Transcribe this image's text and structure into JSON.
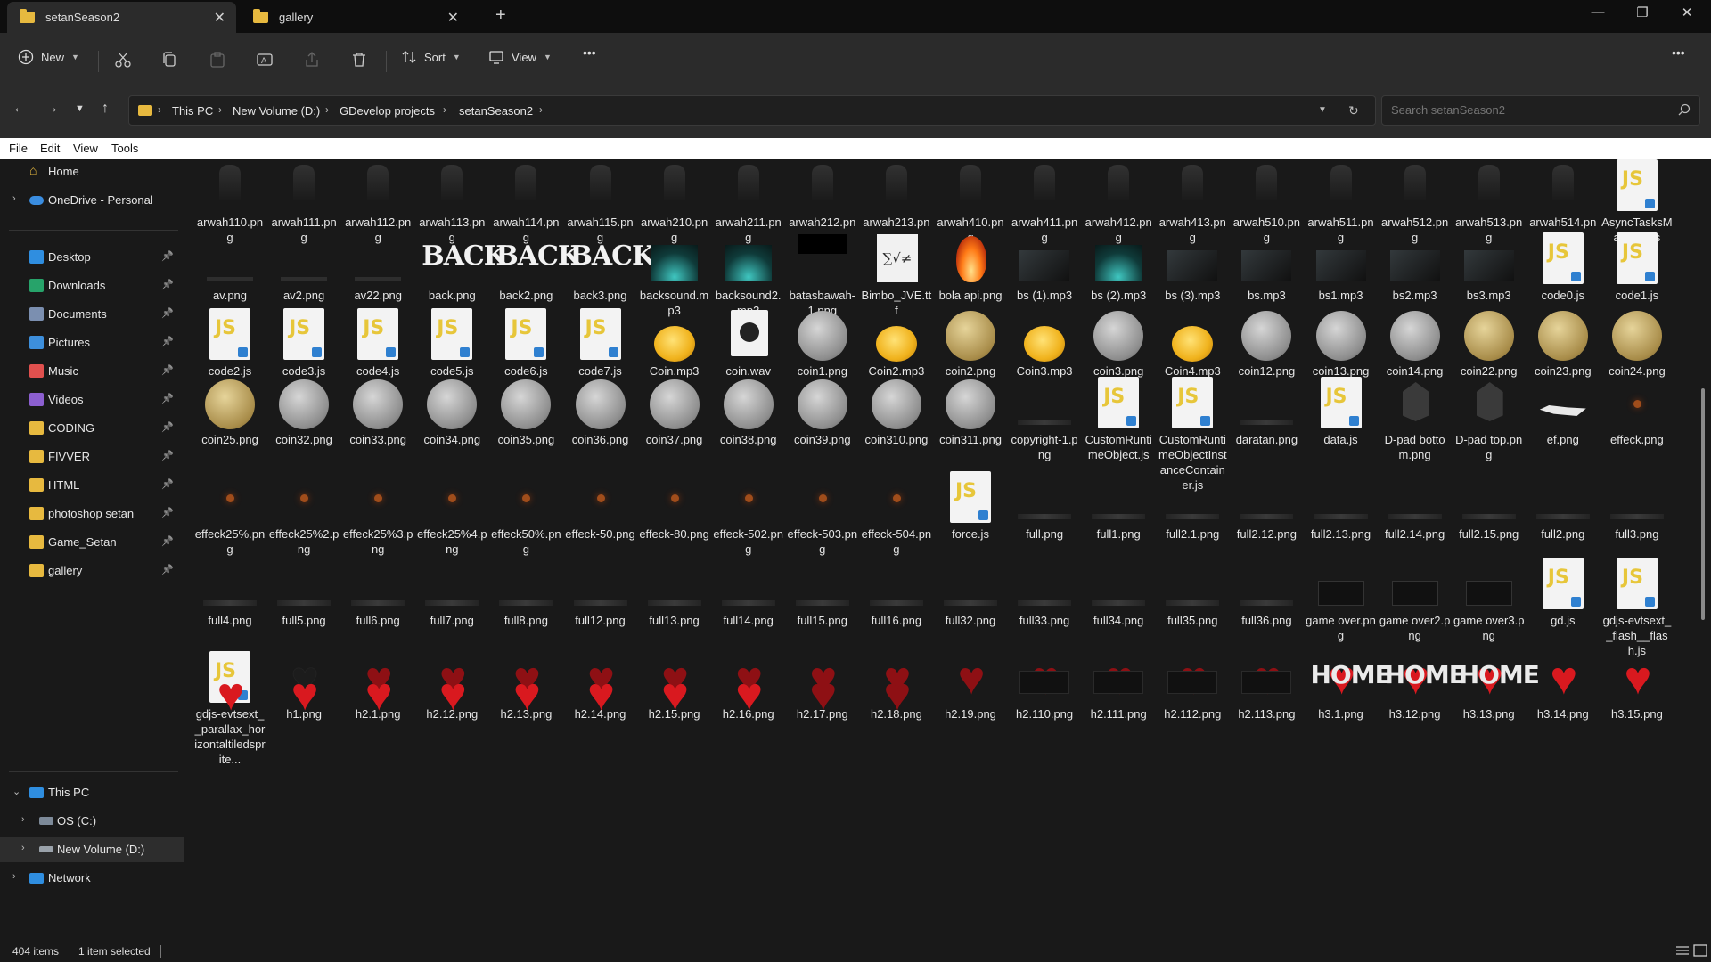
{
  "tabs": [
    {
      "label": "setanSeason2",
      "active": true
    },
    {
      "label": "gallery",
      "active": false
    }
  ],
  "toolbar": {
    "new_label": "New",
    "sort_label": "Sort",
    "view_label": "View",
    "more_label": "•••"
  },
  "breadcrumb": [
    "This PC",
    "New Volume (D:)",
    "GDevelop projects",
    "setanSeason2"
  ],
  "search": {
    "placeholder": "Search setanSeason2"
  },
  "menu": [
    "File",
    "Edit",
    "View",
    "Tools"
  ],
  "sidebar": {
    "home": "Home",
    "onedrive": "OneDrive - Personal",
    "quick": [
      {
        "label": "Desktop",
        "icon": "desktop-icon",
        "color": "#2f8ee0"
      },
      {
        "label": "Downloads",
        "icon": "download-icon",
        "color": "#27a36a"
      },
      {
        "label": "Documents",
        "icon": "documents-icon",
        "color": "#7b8fb0"
      },
      {
        "label": "Pictures",
        "icon": "pictures-icon",
        "color": "#3d8fdc"
      },
      {
        "label": "Music",
        "icon": "music-icon",
        "color": "#e0504e"
      },
      {
        "label": "Videos",
        "icon": "videos-icon",
        "color": "#8c5fd0"
      },
      {
        "label": "CODING",
        "icon": "folder-icon",
        "color": "#e7b93f"
      },
      {
        "label": "FIVVER",
        "icon": "folder-icon",
        "color": "#e7b93f"
      },
      {
        "label": "HTML",
        "icon": "folder-icon",
        "color": "#e7b93f"
      },
      {
        "label": "photoshop setan",
        "icon": "folder-icon",
        "color": "#e7b93f"
      },
      {
        "label": "Game_Setan",
        "icon": "folder-icon",
        "color": "#e7b93f"
      },
      {
        "label": "gallery",
        "icon": "folder-icon",
        "color": "#e7b93f"
      }
    ],
    "this_pc": "This PC",
    "drives": [
      "OS (C:)",
      "New Volume (D:)"
    ],
    "network": "Network"
  },
  "files": [
    {
      "name": "arwah110.png",
      "thumb": "ghost"
    },
    {
      "name": "arwah111.png",
      "thumb": "ghost"
    },
    {
      "name": "arwah112.png",
      "thumb": "ghost"
    },
    {
      "name": "arwah113.png",
      "thumb": "ghost"
    },
    {
      "name": "arwah114.png",
      "thumb": "ghost"
    },
    {
      "name": "arwah115.png",
      "thumb": "ghost"
    },
    {
      "name": "arwah210.png",
      "thumb": "ghost"
    },
    {
      "name": "arwah211.png",
      "thumb": "ghost"
    },
    {
      "name": "arwah212.png",
      "thumb": "ghost"
    },
    {
      "name": "arwah213.png",
      "thumb": "ghost"
    },
    {
      "name": "arwah410.png",
      "thumb": "ghost"
    },
    {
      "name": "arwah411.png",
      "thumb": "ghost"
    },
    {
      "name": "arwah412.png",
      "thumb": "ghost"
    },
    {
      "name": "arwah413.png",
      "thumb": "ghost"
    },
    {
      "name": "arwah510.png",
      "thumb": "ghost"
    },
    {
      "name": "arwah511.png",
      "thumb": "ghost"
    },
    {
      "name": "arwah512.png",
      "thumb": "ghost"
    },
    {
      "name": "arwah513.png",
      "thumb": "ghost"
    },
    {
      "name": "arwah514.png",
      "thumb": "ghost"
    },
    {
      "name": "AsyncTasksManager.js",
      "thumb": "js"
    },
    {
      "name": "av.png",
      "thumb": "strip"
    },
    {
      "name": "av2.png",
      "thumb": "strip"
    },
    {
      "name": "av22.png",
      "thumb": "strip"
    },
    {
      "name": "back.png",
      "thumb": "back",
      "text": "BACK"
    },
    {
      "name": "back2.png",
      "thumb": "back",
      "text": "BACK"
    },
    {
      "name": "back3.png",
      "thumb": "back",
      "text": "BACK"
    },
    {
      "name": "backsound.mp3",
      "thumb": "teal"
    },
    {
      "name": "backsound2.mp3",
      "thumb": "teal"
    },
    {
      "name": "batasbawah-1.png",
      "thumb": "blackbox"
    },
    {
      "name": "Bimbo_JVE.ttf",
      "thumb": "ttf",
      "text": "∑√≠"
    },
    {
      "name": "bola api.png",
      "thumb": "fire"
    },
    {
      "name": "bs (1).mp3",
      "thumb": "darkimg"
    },
    {
      "name": "bs (2).mp3",
      "thumb": "teal"
    },
    {
      "name": "bs (3).mp3",
      "thumb": "darkimg"
    },
    {
      "name": "bs.mp3",
      "thumb": "darkimg"
    },
    {
      "name": "bs1.mp3",
      "thumb": "darkimg"
    },
    {
      "name": "bs2.mp3",
      "thumb": "darkimg"
    },
    {
      "name": "bs3.mp3",
      "thumb": "darkimg"
    },
    {
      "name": "code0.js",
      "thumb": "js"
    },
    {
      "name": "code1.js",
      "thumb": "js"
    },
    {
      "name": "code2.js",
      "thumb": "js"
    },
    {
      "name": "code3.js",
      "thumb": "js"
    },
    {
      "name": "code4.js",
      "thumb": "js"
    },
    {
      "name": "code5.js",
      "thumb": "js"
    },
    {
      "name": "code6.js",
      "thumb": "js"
    },
    {
      "name": "code7.js",
      "thumb": "js"
    },
    {
      "name": "Coin.mp3",
      "thumb": "shine"
    },
    {
      "name": "coin.wav",
      "thumb": "wav"
    },
    {
      "name": "coin1.png",
      "thumb": "silver"
    },
    {
      "name": "Coin2.mp3",
      "thumb": "shine"
    },
    {
      "name": "coin2.png",
      "thumb": "gold"
    },
    {
      "name": "Coin3.mp3",
      "thumb": "shine"
    },
    {
      "name": "coin3.png",
      "thumb": "silver"
    },
    {
      "name": "Coin4.mp3",
      "thumb": "shine"
    },
    {
      "name": "coin12.png",
      "thumb": "silver"
    },
    {
      "name": "coin13.png",
      "thumb": "silver"
    },
    {
      "name": "coin14.png",
      "thumb": "silver"
    },
    {
      "name": "coin22.png",
      "thumb": "gold"
    },
    {
      "name": "coin23.png",
      "thumb": "gold"
    },
    {
      "name": "coin24.png",
      "thumb": "gold"
    },
    {
      "name": "coin25.png",
      "thumb": "gold"
    },
    {
      "name": "coin32.png",
      "thumb": "silver"
    },
    {
      "name": "coin33.png",
      "thumb": "silver"
    },
    {
      "name": "coin34.png",
      "thumb": "silver"
    },
    {
      "name": "coin35.png",
      "thumb": "silver"
    },
    {
      "name": "coin36.png",
      "thumb": "silver"
    },
    {
      "name": "coin37.png",
      "thumb": "silver"
    },
    {
      "name": "coin38.png",
      "thumb": "silver"
    },
    {
      "name": "coin39.png",
      "thumb": "silver"
    },
    {
      "name": "coin310.png",
      "thumb": "silver"
    },
    {
      "name": "coin311.png",
      "thumb": "silver"
    },
    {
      "name": "copyright-1.png",
      "thumb": "line"
    },
    {
      "name": "CustomRuntimeObject.js",
      "thumb": "js"
    },
    {
      "name": "CustomRuntimeObjectInstanceContainer.js",
      "thumb": "js"
    },
    {
      "name": "daratan.png",
      "thumb": "line"
    },
    {
      "name": "data.js",
      "thumb": "js"
    },
    {
      "name": "D-pad bottom.png",
      "thumb": "shield"
    },
    {
      "name": "D-pad top.png",
      "thumb": "shield"
    },
    {
      "name": "ef.png",
      "thumb": "ef"
    },
    {
      "name": "effeck.png",
      "thumb": "glow"
    },
    {
      "name": "effeck25%.png",
      "thumb": "glow"
    },
    {
      "name": "effeck25%2.png",
      "thumb": "glow"
    },
    {
      "name": "effeck25%3.png",
      "thumb": "glow"
    },
    {
      "name": "effeck25%4.png",
      "thumb": "glow"
    },
    {
      "name": "effeck50%.png",
      "thumb": "glow"
    },
    {
      "name": "effeck-50.png",
      "thumb": "glow"
    },
    {
      "name": "effeck-80.png",
      "thumb": "glow"
    },
    {
      "name": "effeck-502.png",
      "thumb": "glow"
    },
    {
      "name": "effeck-503.png",
      "thumb": "glow"
    },
    {
      "name": "effeck-504.png",
      "thumb": "glow"
    },
    {
      "name": "force.js",
      "thumb": "js"
    },
    {
      "name": "full.png",
      "thumb": "line"
    },
    {
      "name": "full1.png",
      "thumb": "line"
    },
    {
      "name": "full2.1.png",
      "thumb": "line"
    },
    {
      "name": "full2.12.png",
      "thumb": "line"
    },
    {
      "name": "full2.13.png",
      "thumb": "line"
    },
    {
      "name": "full2.14.png",
      "thumb": "line"
    },
    {
      "name": "full2.15.png",
      "thumb": "line"
    },
    {
      "name": "full2.png",
      "thumb": "line"
    },
    {
      "name": "full3.png",
      "thumb": "line"
    },
    {
      "name": "full4.png",
      "thumb": "line"
    },
    {
      "name": "full5.png",
      "thumb": "line"
    },
    {
      "name": "full6.png",
      "thumb": "line"
    },
    {
      "name": "full7.png",
      "thumb": "line"
    },
    {
      "name": "full8.png",
      "thumb": "line"
    },
    {
      "name": "full12.png",
      "thumb": "line"
    },
    {
      "name": "full13.png",
      "thumb": "line"
    },
    {
      "name": "full14.png",
      "thumb": "line"
    },
    {
      "name": "full15.png",
      "thumb": "line"
    },
    {
      "name": "full16.png",
      "thumb": "line"
    },
    {
      "name": "full32.png",
      "thumb": "line"
    },
    {
      "name": "full33.png",
      "thumb": "line"
    },
    {
      "name": "full34.png",
      "thumb": "line"
    },
    {
      "name": "full35.png",
      "thumb": "line"
    },
    {
      "name": "full36.png",
      "thumb": "line"
    },
    {
      "name": "game over.png",
      "thumb": "gameover"
    },
    {
      "name": "game over2.png",
      "thumb": "gameover-red"
    },
    {
      "name": "game over3.png",
      "thumb": "gameover"
    },
    {
      "name": "gd.js",
      "thumb": "js"
    },
    {
      "name": "gdjs-evtsext__flash__flash.js",
      "thumb": "js"
    },
    {
      "name": "gdjs-evtsext__parallax_horizontaltiledsprite...",
      "thumb": "js"
    },
    {
      "name": "h1.png",
      "thumb": "heart-outline"
    },
    {
      "name": "h2.1.png",
      "thumb": "heart-broken"
    },
    {
      "name": "h2.12.png",
      "thumb": "heart-broken"
    },
    {
      "name": "h2.13.png",
      "thumb": "heart-broken"
    },
    {
      "name": "h2.14.png",
      "thumb": "heart-broken"
    },
    {
      "name": "h2.15.png",
      "thumb": "heart-broken"
    },
    {
      "name": "h2.16.png",
      "thumb": "heart-broken"
    },
    {
      "name": "h2.17.png",
      "thumb": "heart-broken"
    },
    {
      "name": "h2.18.png",
      "thumb": "heart-broken"
    },
    {
      "name": "h2.19.png",
      "thumb": "heart-broken"
    },
    {
      "name": "h2.110.png",
      "thumb": "heart-broken"
    },
    {
      "name": "h2.111.png",
      "thumb": "heart-broken"
    },
    {
      "name": "h2.112.png",
      "thumb": "heart-broken"
    },
    {
      "name": "h2.113.png",
      "thumb": "heart-broken"
    },
    {
      "name": "h3.1.png",
      "thumb": "heart"
    },
    {
      "name": "h3.12.png",
      "thumb": "heart"
    },
    {
      "name": "h3.13.png",
      "thumb": "heart"
    },
    {
      "name": "h3.14.png",
      "thumb": "heart"
    },
    {
      "name": "h3.15.png",
      "thumb": "heart"
    }
  ],
  "partial_row": [
    {
      "thumb": "heart"
    },
    {
      "thumb": "heart"
    },
    {
      "thumb": "heart"
    },
    {
      "thumb": "heart"
    },
    {
      "thumb": "heart"
    },
    {
      "thumb": "heart"
    },
    {
      "thumb": "heart"
    },
    {
      "thumb": "heart"
    },
    {
      "thumb": "heart-broken"
    },
    {
      "thumb": "heart-broken"
    },
    {
      "thumb": "none"
    },
    {
      "thumb": "small-dark"
    },
    {
      "thumb": "small-dark"
    },
    {
      "thumb": "small-dark"
    },
    {
      "thumb": "small-dark"
    },
    {
      "thumb": "home",
      "text": "HOME"
    },
    {
      "thumb": "home",
      "text": "HOME"
    },
    {
      "thumb": "home",
      "text": "HOME"
    },
    {
      "thumb": "none"
    },
    {
      "thumb": "none"
    }
  ],
  "status": {
    "items": "404 items",
    "selected": "1 item selected"
  }
}
